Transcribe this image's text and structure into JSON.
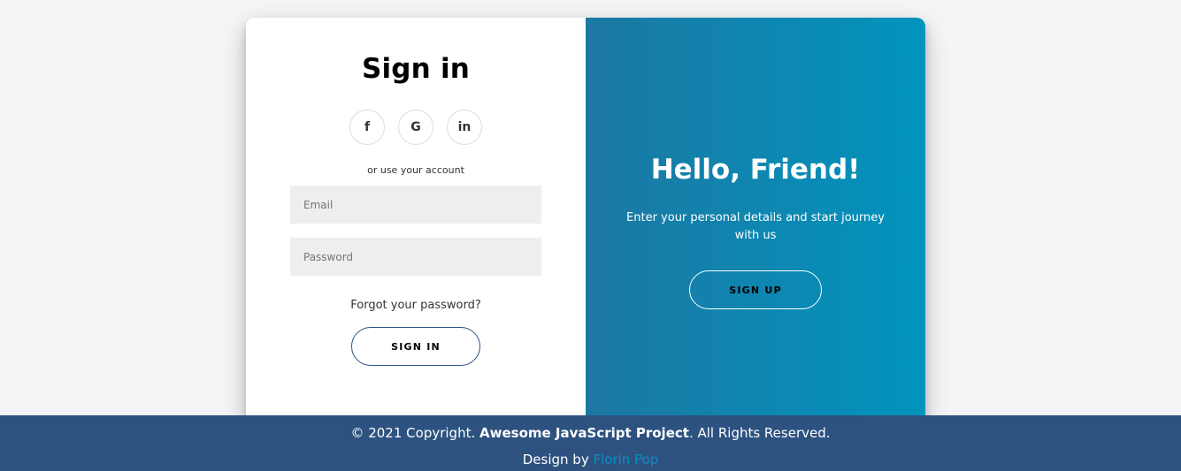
{
  "signin": {
    "title": "Sign in",
    "social": [
      {
        "icon": "facebook-icon",
        "glyph": "f"
      },
      {
        "icon": "google-icon",
        "glyph": "G"
      },
      {
        "icon": "linkedin-icon",
        "glyph": "in"
      }
    ],
    "alt_text": "or use your account",
    "email_placeholder": "Email",
    "password_placeholder": "Password",
    "forgot_label": "Forgot your password?",
    "button_label": "SIGN IN"
  },
  "overlay": {
    "title": "Hello, Friend!",
    "text": "Enter your personal details and start journey with us",
    "button_label": "SIGN UP",
    "gradient_start": "#1c78a3",
    "gradient_end": "#0094bd"
  },
  "footer": {
    "copyright_prefix": "© 2021 Copyright. ",
    "project_name": "Awesome JavaScript Project",
    "copyright_suffix": ". All Rights Reserved.",
    "design_prefix": "Design by ",
    "designer": "Florin Pop",
    "background": "#2d5280"
  }
}
